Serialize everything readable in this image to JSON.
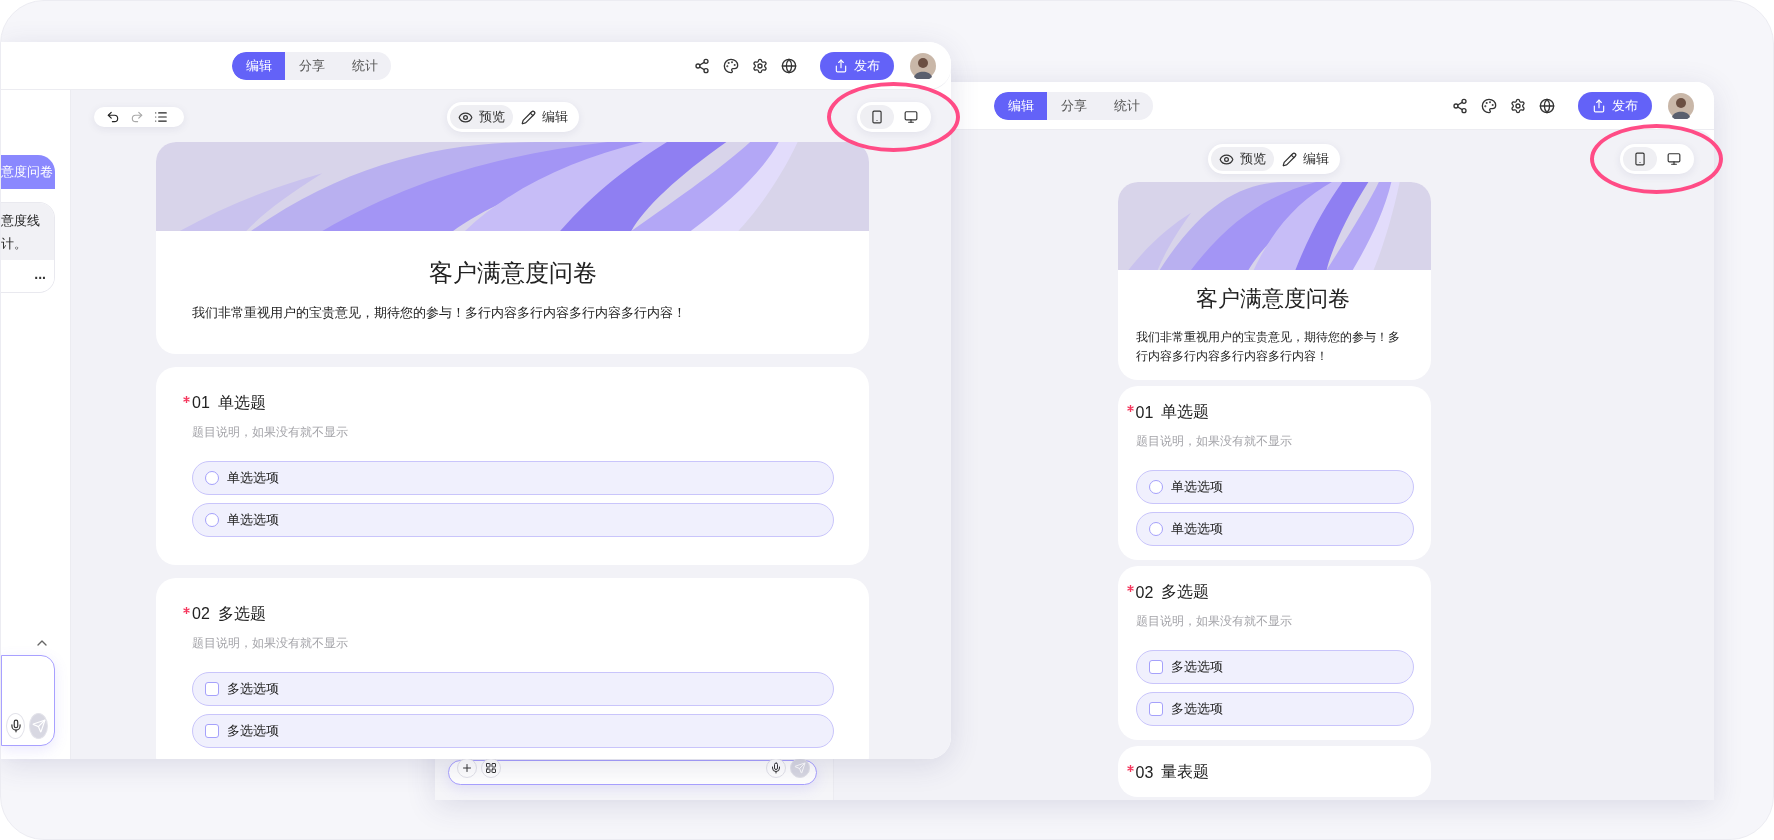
{
  "windows": [
    {
      "kind": "back",
      "tabs": [
        {
          "label": "编辑",
          "selected": true
        },
        {
          "label": "分享",
          "selected": false
        },
        {
          "label": "统计",
          "selected": false
        }
      ],
      "publish": "发布",
      "view_modes": [
        {
          "kind": "preview",
          "label": "预览",
          "selected": true
        },
        {
          "kind": "edit",
          "label": "编辑",
          "selected": false
        }
      ],
      "devices": [
        {
          "kind": "phone",
          "selected": true
        },
        {
          "kind": "desktop",
          "selected": false
        }
      ],
      "device_highlight": true,
      "composer": {
        "tools": [
          {
            "kind": "add"
          },
          {
            "kind": "apps"
          },
          {
            "kind": "voice"
          },
          {
            "kind": "send"
          }
        ]
      },
      "survey": {
        "title": "客户满意度问卷",
        "description": "我们非常重视用户的宝贵意见，期待您的参与！多行内容多行内容多行内容多行内容！",
        "questions": [
          {
            "number": "01",
            "title": "单选题",
            "required": true,
            "hint": "题目说明，如果没有就不显示",
            "kind": "single",
            "options": [
              {
                "label": "单选选项",
                "checked": false
              },
              {
                "label": "单选选项",
                "checked": false
              }
            ]
          },
          {
            "number": "02",
            "title": "多选题",
            "required": true,
            "hint": "题目说明，如果没有就不显示",
            "kind": "multi",
            "options": [
              {
                "label": "多选选项",
                "checked": false
              },
              {
                "label": "多选选项",
                "checked": false
              }
            ]
          },
          {
            "number": "03",
            "title": "量表题",
            "required": true,
            "kind": "scale"
          }
        ]
      }
    },
    {
      "kind": "front",
      "tabs": [
        {
          "label": "编辑",
          "selected": true
        },
        {
          "label": "分享",
          "selected": false
        },
        {
          "label": "统计",
          "selected": false
        }
      ],
      "publish": "发布",
      "history_tools": true,
      "view_modes": [
        {
          "kind": "preview",
          "label": "预览",
          "selected": true
        },
        {
          "kind": "edit",
          "label": "编辑",
          "selected": false
        }
      ],
      "devices": [
        {
          "kind": "phone",
          "selected": true
        },
        {
          "kind": "desktop",
          "selected": false
        }
      ],
      "device_highlight": true,
      "sidebar": {
        "user_message": "意度问卷",
        "reply_lines": [
          "意度线",
          "计。"
        ],
        "more": "..."
      },
      "composer": {
        "tools": [
          {
            "kind": "voice"
          },
          {
            "kind": "send"
          }
        ]
      },
      "survey": {
        "title": "客户满意度问卷",
        "description": "我们非常重视用户的宝贵意见，期待您的参与！多行内容多行内容多行内容多行内容！",
        "questions": [
          {
            "number": "01",
            "title": "单选题",
            "required": true,
            "hint": "题目说明，如果没有就不显示",
            "kind": "single",
            "options": [
              {
                "label": "单选选项",
                "checked": false
              },
              {
                "label": "单选选项",
                "checked": false
              }
            ]
          },
          {
            "number": "02",
            "title": "多选题",
            "required": true,
            "hint": "题目说明，如果没有就不显示",
            "kind": "multi",
            "options": [
              {
                "label": "多选选项",
                "checked": false
              },
              {
                "label": "多选选项",
                "checked": false
              }
            ]
          }
        ]
      }
    }
  ]
}
